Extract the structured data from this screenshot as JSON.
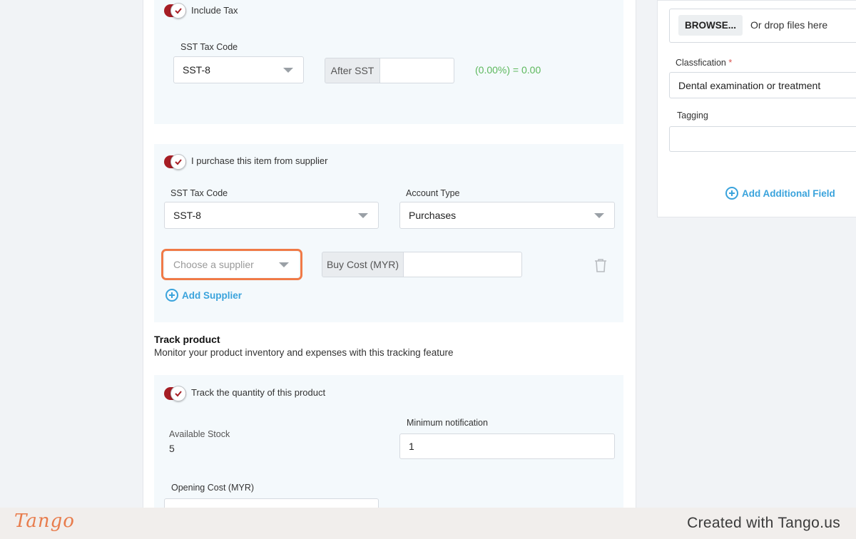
{
  "tax_section": {
    "toggle_label": "Include Tax",
    "sst_label": "SST Tax Code",
    "sst_value": "SST-8",
    "after_sst_label": "After SST",
    "after_sst_value": "",
    "computed_text": "(0.00%) = 0.00"
  },
  "supplier_section": {
    "toggle_label": "I purchase this item from supplier",
    "sst_label": "SST Tax Code",
    "sst_value": "SST-8",
    "account_type_label": "Account Type",
    "account_type_value": "Purchases",
    "supplier_placeholder": "Choose a supplier",
    "buy_cost_label": "Buy Cost (MYR)",
    "buy_cost_value": "",
    "add_supplier_label": "Add Supplier"
  },
  "track": {
    "title": "Track product",
    "description": "Monitor your product inventory and expenses with this tracking feature",
    "toggle_label": "Track the quantity of this product",
    "available_stock_label": "Available Stock",
    "available_stock_value": "5",
    "min_notification_label": "Minimum notification",
    "min_notification_value": "1",
    "opening_cost_label": "Opening Cost (MYR)"
  },
  "side": {
    "browse_label": "BROWSE...",
    "drop_text": "Or drop files here",
    "classification_label": "Classfication",
    "required_mark": "*",
    "classification_value": "Dental examination or treatment",
    "tagging_label": "Tagging",
    "tagging_value": "",
    "add_field_label": "Add Additional Field"
  },
  "footer": {
    "logo": "Tango",
    "created_text": "Created with Tango.us"
  },
  "colors": {
    "toggle_on": "#a61d24",
    "highlight": "#f07a47",
    "link": "#3aa3dc",
    "computed_green": "#5cb85c",
    "panel_bg": "#f4f9fc"
  }
}
